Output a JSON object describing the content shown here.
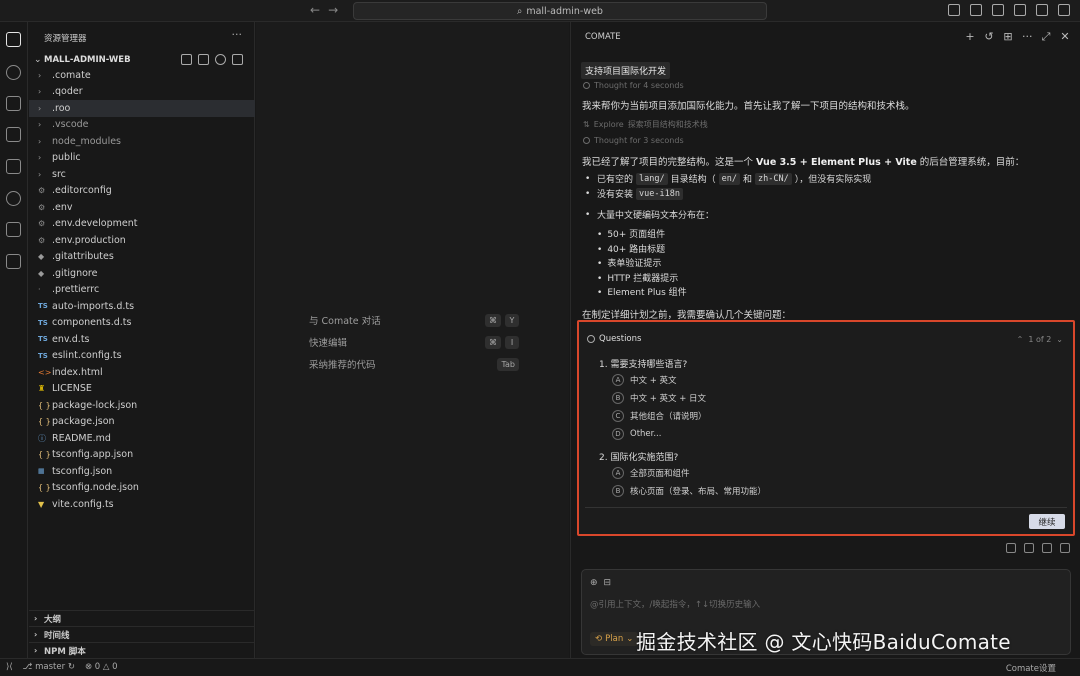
{
  "window": {
    "search_text": "mall-admin-web",
    "search_icon": "search-icon"
  },
  "sidebar": {
    "title": "资源管理器",
    "project": "MALL-ADMIN-WEB",
    "files": [
      {
        "name": ".comate",
        "kind": "folder"
      },
      {
        "name": ".qoder",
        "kind": "folder"
      },
      {
        "name": ".roo",
        "kind": "folder",
        "selected": true
      },
      {
        "name": ".vscode",
        "kind": "folder",
        "dim": true
      },
      {
        "name": "node_modules",
        "kind": "folder",
        "dim": true
      },
      {
        "name": "public",
        "kind": "folder"
      },
      {
        "name": "src",
        "kind": "folder"
      },
      {
        "name": ".editorconfig",
        "kind": "gear"
      },
      {
        "name": ".env",
        "kind": "gear"
      },
      {
        "name": ".env.development",
        "kind": "gear"
      },
      {
        "name": ".env.production",
        "kind": "gear"
      },
      {
        "name": ".gitattributes",
        "kind": "git"
      },
      {
        "name": ".gitignore",
        "kind": "git"
      },
      {
        "name": ".prettierrc",
        "kind": "file"
      },
      {
        "name": "auto-imports.d.ts",
        "kind": "ts"
      },
      {
        "name": "components.d.ts",
        "kind": "ts"
      },
      {
        "name": "env.d.ts",
        "kind": "ts"
      },
      {
        "name": "eslint.config.ts",
        "kind": "ts"
      },
      {
        "name": "index.html",
        "kind": "html"
      },
      {
        "name": "LICENSE",
        "kind": "license"
      },
      {
        "name": "package-lock.json",
        "kind": "json"
      },
      {
        "name": "package.json",
        "kind": "json"
      },
      {
        "name": "README.md",
        "kind": "info"
      },
      {
        "name": "tsconfig.app.json",
        "kind": "json"
      },
      {
        "name": "tsconfig.json",
        "kind": "tsjson"
      },
      {
        "name": "tsconfig.node.json",
        "kind": "json"
      },
      {
        "name": "vite.config.ts",
        "kind": "vite"
      }
    ],
    "sections": [
      "大纲",
      "时间线",
      "NPM 脚本"
    ]
  },
  "editor": {
    "hints": [
      {
        "label": "与 Comate 对话",
        "keys": [
          "⌘",
          "Y"
        ]
      },
      {
        "label": "快速编辑",
        "keys": [
          "⌘",
          "I"
        ]
      },
      {
        "label": "采纳推荐的代码",
        "keys": [
          "Tab"
        ]
      }
    ]
  },
  "panel": {
    "title": "COMATE",
    "chat_title": "支持项目国际化开发",
    "thought1": "Thought for 4 seconds",
    "intro": "我来帮你为当前项目添加国际化能力。首先让我了解一下项目的结构和技术栈。",
    "explore_label": "Explore",
    "explore_desc": "探索项目结构和技术栈",
    "thought2": "Thought for 3 seconds",
    "summary_prefix": "我已经了解了项目的完整结构。这是一个",
    "summary_stack": "Vue 3.5 + Element Plus + Vite",
    "summary_suffix": "的后台管理系统，目前：",
    "b1_prefix": "已有空的",
    "b1_code1": "lang/",
    "b1_mid": "目录结构（",
    "b1_code2": "en/",
    "b1_and": "和",
    "b1_code3": "zh-CN/",
    "b1_suffix": "），但没有实际实现",
    "b2_prefix": "没有安装",
    "b2_code": "vue-i18n",
    "b3": "大量中文硬编码文本分布在：",
    "sub_bullets": [
      "50+ 页面组件",
      "40+ 路由标题",
      "表单验证提示",
      "HTTP 拦截器提示",
      "Element Plus 组件"
    ],
    "before_plan": "在制定详细计划之前，我需要确认几个关键问题：",
    "questions_label": "Questions",
    "pager": "1 of 2",
    "q1": "1. 需要支持哪些语言?",
    "q1_options": [
      {
        "letter": "A",
        "text": "中文 + 英文"
      },
      {
        "letter": "B",
        "text": "中文 + 英文 + 日文"
      },
      {
        "letter": "C",
        "text": "其他组合（请说明）"
      },
      {
        "letter": "D",
        "text": "Other..."
      }
    ],
    "q2": "2. 国际化实施范围?",
    "q2_options": [
      {
        "letter": "A",
        "text": "全部页面和组件"
      },
      {
        "letter": "B",
        "text": "核心页面（登录、布局、常用功能）"
      }
    ],
    "continue": "继续",
    "input_placeholder": "@引用上下文，/唤起指令，↑↓切换历史输入",
    "mode": "Plan"
  },
  "watermark": "掘金技术社区 @ 文心快码BaiduComate",
  "status": {
    "branch": "master",
    "errors": "0",
    "warnings": "0",
    "settings": "Comate设置"
  },
  "colors": {
    "highlight_border": "#d9472b",
    "plan_accent": "#d8a24a"
  }
}
